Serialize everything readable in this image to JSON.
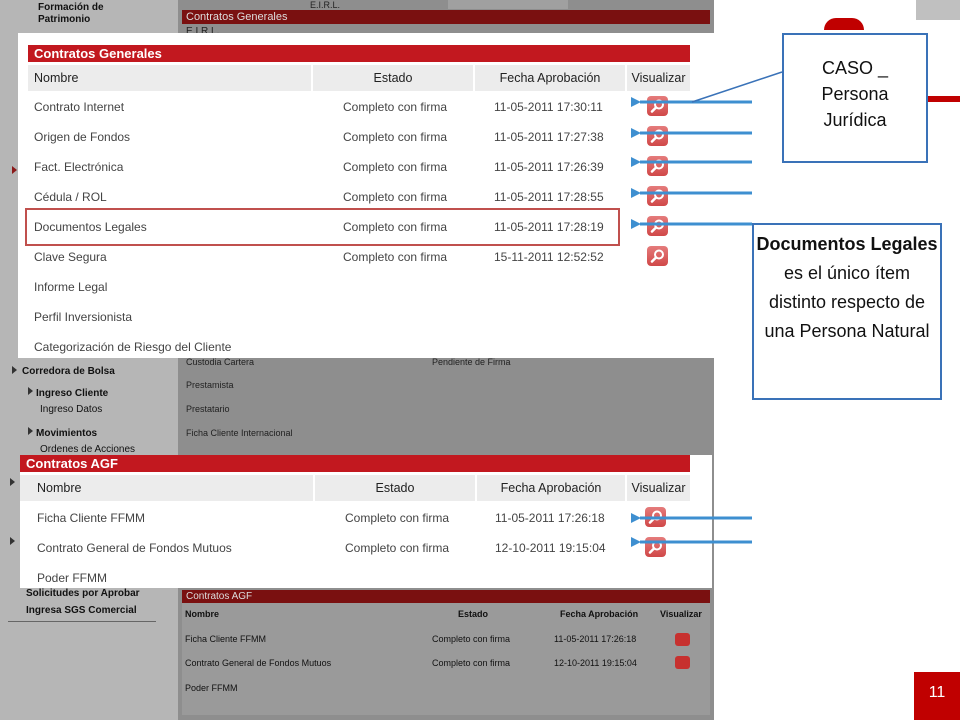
{
  "background": {
    "sidebar": {
      "items": [
        "Formación de Patrimonio",
        "Corredora de Bolsa",
        "Ingreso Cliente",
        "Ingreso Datos",
        "Movimientos",
        "Ordenes de Acciones",
        "Solicitudes por Aprobar",
        "Ingresa SGS Comercial"
      ]
    },
    "top_header": "Contratos Generales",
    "top_label": "E.I.R.L.",
    "top_cell": "E.I.R.L.",
    "rows": [
      {
        "name": "Custodia Cartera",
        "status": "Pendiente de Firma"
      },
      {
        "name": "Prestamista",
        "status": ""
      },
      {
        "name": "Prestatario",
        "status": ""
      },
      {
        "name": "Ficha Cliente Internacional",
        "status": ""
      }
    ],
    "agf": {
      "title": "Contratos AGF",
      "columns": [
        "Nombre",
        "Estado",
        "Fecha Aprobación",
        "Visualizar"
      ],
      "rows": [
        {
          "name": "Ficha Cliente FFMM",
          "status": "Completo con firma",
          "date": "11-05-2011 17:26:18"
        },
        {
          "name": "Contrato General de Fondos Mutuos",
          "status": "Completo con firma",
          "date": "12-10-2011 19:15:04"
        },
        {
          "name": "Poder FFMM",
          "status": "",
          "date": ""
        }
      ]
    }
  },
  "contratos_generales": {
    "title": "Contratos Generales",
    "columns": [
      "Nombre",
      "Estado",
      "Fecha Aprobación",
      "Visualizar"
    ],
    "rows": [
      {
        "name": "Contrato Internet",
        "status": "Completo con firma",
        "date": "11-05-2011 17:30:11",
        "has_icon": true
      },
      {
        "name": "Origen de Fondos",
        "status": "Completo con firma",
        "date": "11-05-2011 17:27:38",
        "has_icon": true
      },
      {
        "name": "Fact. Electrónica",
        "status": "Completo con firma",
        "date": "11-05-2011 17:26:39",
        "has_icon": true
      },
      {
        "name": "Cédula / ROL",
        "status": "Completo con firma",
        "date": "11-05-2011 17:28:55",
        "has_icon": true
      },
      {
        "name": "Documentos Legales",
        "status": "Completo con firma",
        "date": "11-05-2011 17:28:19",
        "has_icon": true
      },
      {
        "name": "Clave Segura",
        "status": "Completo con firma",
        "date": "15-11-2011 12:52:52",
        "has_icon": true
      },
      {
        "name": "Informe Legal",
        "status": "",
        "date": "",
        "has_icon": false
      },
      {
        "name": "Perfil Inversionista",
        "status": "",
        "date": "",
        "has_icon": false
      },
      {
        "name": "Categorización de Riesgo del Cliente",
        "status": "",
        "date": "",
        "has_icon": false
      }
    ]
  },
  "contratos_agf": {
    "title": "Contratos AGF",
    "columns": [
      "Nombre",
      "Estado",
      "Fecha Aprobación",
      "Visualizar"
    ],
    "rows": [
      {
        "name": "Ficha Cliente FFMM",
        "status": "Completo con firma",
        "date": "11-05-2011 17:26:18",
        "has_icon": true
      },
      {
        "name": "Contrato General de Fondos Mutuos",
        "status": "Completo con firma",
        "date": "12-10-2011 19:15:04",
        "has_icon": true
      },
      {
        "name": "Poder FFMM",
        "status": "",
        "date": "",
        "has_icon": false
      }
    ]
  },
  "callouts": {
    "caso_lines": [
      "CASO _",
      "Persona",
      "Jurídica"
    ],
    "docs_bold": "Documentos Legales",
    "docs_rest": " es el único ítem distinto respecto de una Persona Natural"
  },
  "page_number": "11",
  "colors": {
    "header_red": "#c2181f",
    "callout_border": "#3a72b8",
    "arrow": "#3e8fd0",
    "highlight": "#c0504d"
  },
  "icons": {
    "visualizar": "magnifier-icon",
    "sidebar_marker": "triangle-right-icon"
  }
}
